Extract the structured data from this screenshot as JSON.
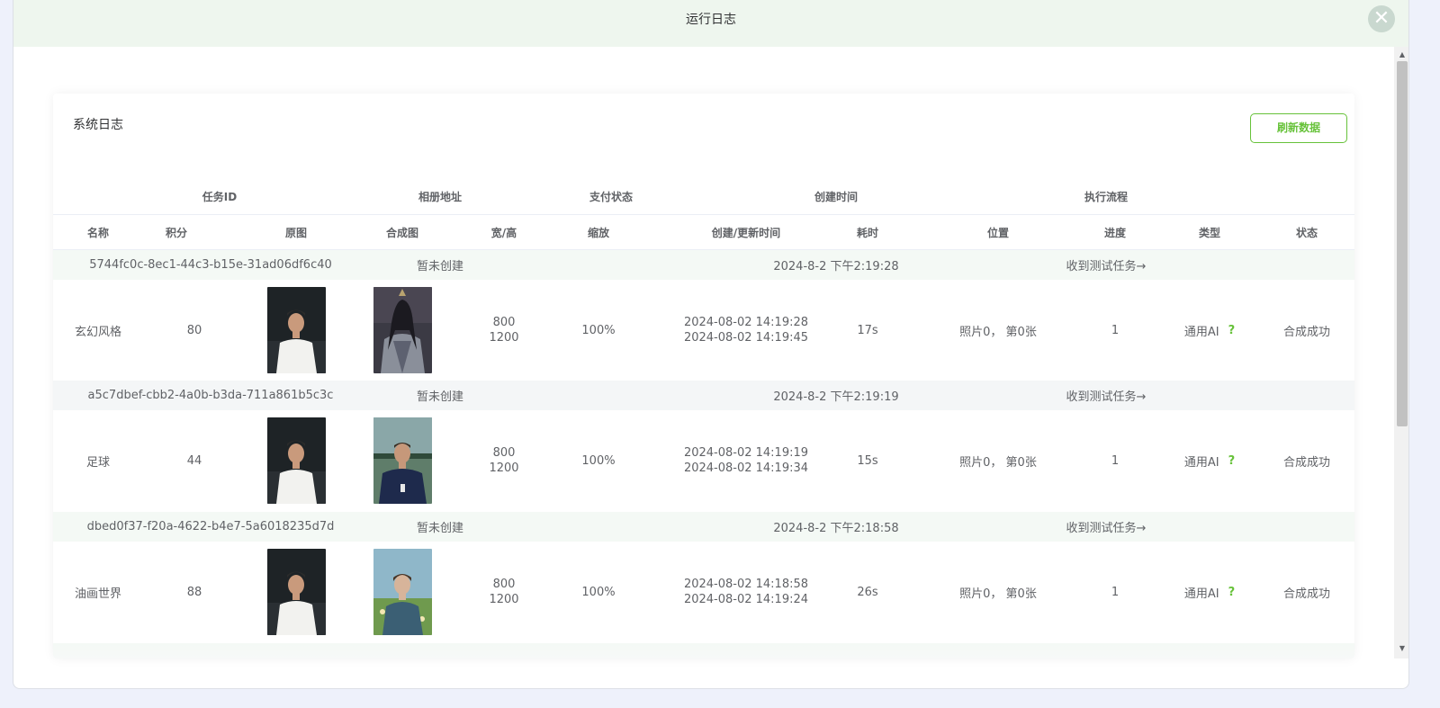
{
  "modal": {
    "title": "运行日志",
    "close": "✕"
  },
  "card": {
    "title": "系统日志",
    "refresh_label": "刷新数据"
  },
  "group_headers": [
    "任务ID",
    "相册地址",
    "支付状态",
    "创建时间",
    "执行流程"
  ],
  "columns": [
    "名称",
    "积分",
    "原图",
    "合成图",
    "宽/高",
    "缩放",
    "创建/更新时间",
    "耗时",
    "位置",
    "进度",
    "类型",
    "状态"
  ],
  "records": [
    {
      "task_id": "5744fc0c-8ec1-44c3-b15e-31ad06df6c40",
      "album": "暂未创建",
      "created": "2024-8-2 下午2:19:28",
      "flow": "收到测试任务→",
      "name": "玄幻风格",
      "points": "80",
      "width": "800",
      "height": "1200",
      "scale": "100%",
      "created_at": "2024-08-02 14:19:28",
      "updated_at": "2024-08-02 14:19:45",
      "duration": "17s",
      "position": "照片0， 第0张",
      "progress": "1",
      "type": "通用AI",
      "type_hint": "?",
      "status": "合成成功"
    },
    {
      "task_id": "a5c7dbef-cbb2-4a0b-b3da-711a861b5c3c",
      "album": "暂未创建",
      "created": "2024-8-2 下午2:19:19",
      "flow": "收到测试任务→",
      "name": "足球",
      "points": "44",
      "width": "800",
      "height": "1200",
      "scale": "100%",
      "created_at": "2024-08-02 14:19:19",
      "updated_at": "2024-08-02 14:19:34",
      "duration": "15s",
      "position": "照片0， 第0张",
      "progress": "1",
      "type": "通用AI",
      "type_hint": "?",
      "status": "合成成功"
    },
    {
      "task_id": "dbed0f37-f20a-4622-b4e7-5a6018235d7d",
      "album": "暂未创建",
      "created": "2024-8-2 下午2:18:58",
      "flow": "收到测试任务→",
      "name": "油画世界",
      "points": "88",
      "width": "800",
      "height": "1200",
      "scale": "100%",
      "created_at": "2024-08-02 14:18:58",
      "updated_at": "2024-08-02 14:19:24",
      "duration": "26s",
      "position": "照片0， 第0张",
      "progress": "1",
      "type": "通用AI",
      "type_hint": "?",
      "status": "合成成功"
    }
  ],
  "colors": {
    "accent": "#67c23a",
    "header_bg": "#eef6ee",
    "page_bg": "#eef1fb"
  }
}
